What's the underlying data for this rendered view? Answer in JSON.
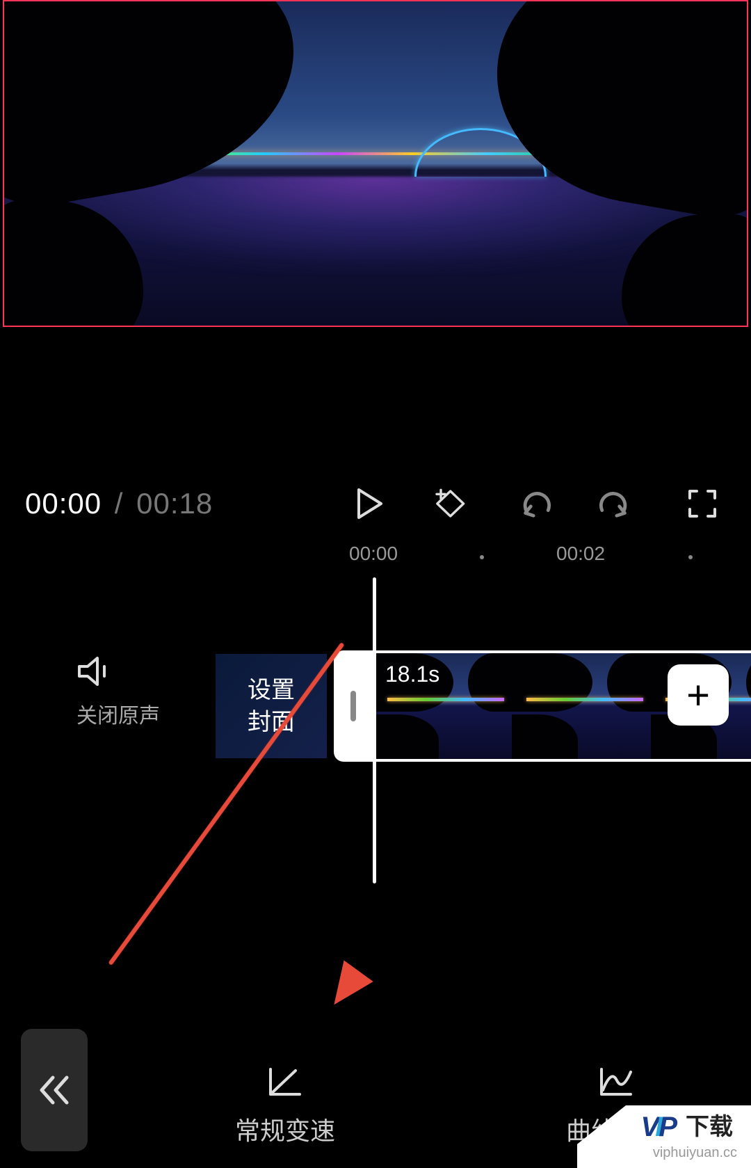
{
  "playback": {
    "current_time": "00:00",
    "separator": "/",
    "total_time": "00:18"
  },
  "ruler": {
    "tick_0": "00:00",
    "tick_1": "00:02"
  },
  "timeline": {
    "mute_label": "关闭原声",
    "cover_line1": "设置",
    "cover_line2": "封面",
    "clip_duration": "18.1s",
    "add_label": "+"
  },
  "tools": {
    "normal_speed": "常规变速",
    "curve_speed": "曲线变速"
  },
  "watermark": {
    "vip": "VIP",
    "dl": "下载",
    "url": "viphuiyuan.cc"
  },
  "icons": {
    "play": "play-icon",
    "keyframe": "keyframe-add-icon",
    "undo": "undo-icon",
    "redo": "redo-icon",
    "fullscreen": "fullscreen-icon",
    "speaker": "speaker-icon",
    "back": "chevron-double-left-icon",
    "normal_speed": "speed-normal-icon",
    "curve_speed": "speed-curve-icon"
  }
}
